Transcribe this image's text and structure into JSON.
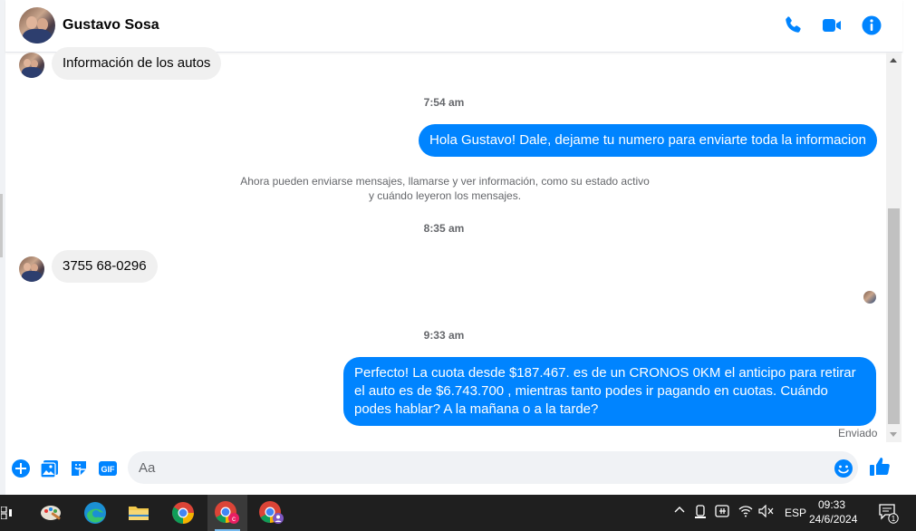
{
  "header": {
    "contact_name": "Gustavo Sosa",
    "icons": [
      "phone-icon",
      "video-icon",
      "info-icon"
    ]
  },
  "messages": {
    "first_incoming": "Información de los autos",
    "time_1": "7:54 am",
    "outgoing_1": "Hola Gustavo! Dale, dejame tu numero para enviarte toda la informacion",
    "system_note": "Ahora pueden enviarse mensajes, llamarse y ver información, como su estado activo y cuándo leyeron los mensajes.",
    "time_2": "8:35 am",
    "incoming_2": "3755 68-0296",
    "time_3": "9:33 am",
    "outgoing_2": "Perfecto! La cuota desde $187.467. es de un CRONOS 0KM el anticipo para retirar el auto es de $6.743.700 , mientras tanto podes ir pagando en cuotas. Cuándo podes hablar? A la mañana o a la tarde?",
    "status": "Enviado"
  },
  "composer": {
    "placeholder": "Aa",
    "icons": [
      "plus-icon",
      "image-icon",
      "sticker-icon",
      "gif-icon",
      "emoji-icon",
      "like-icon"
    ],
    "gif_label": "GIF"
  },
  "taskbar": {
    "language": "ESP",
    "time": "09:33",
    "date": "24/6/2024",
    "notification_count": "1"
  },
  "colors": {
    "accent": "#0084ff",
    "incoming_bubble": "#f0f0f0",
    "taskbar": "#1f1f1f"
  }
}
